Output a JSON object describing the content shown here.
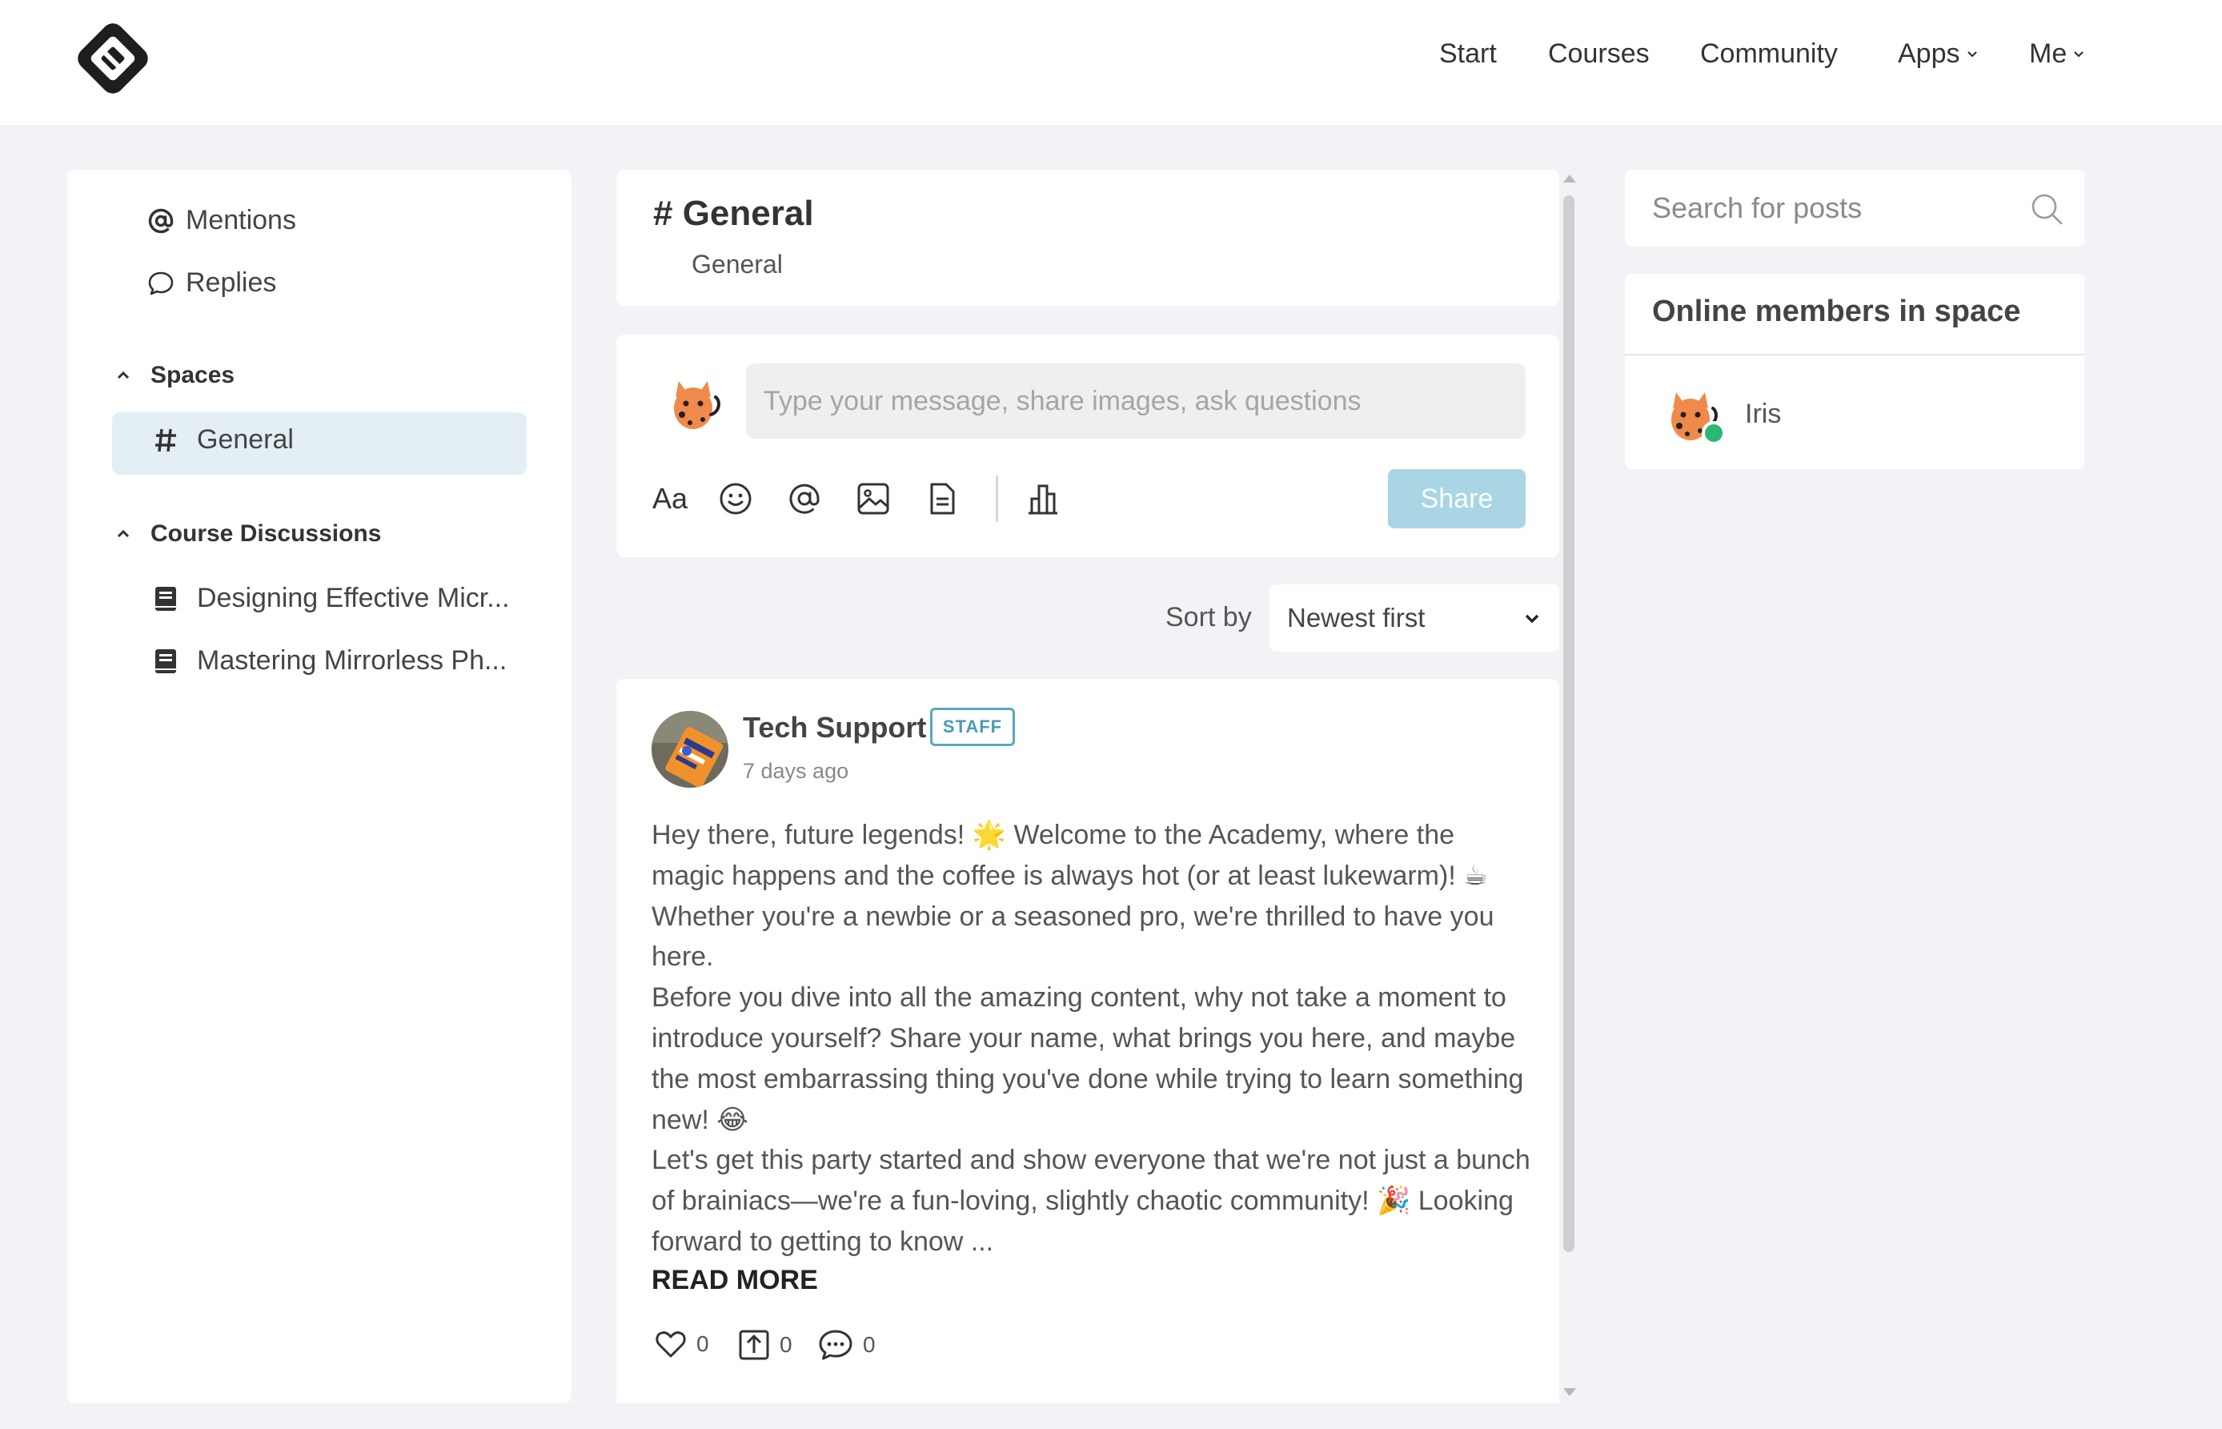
{
  "nav": {
    "items": [
      {
        "label": "Start"
      },
      {
        "label": "Courses"
      },
      {
        "label": "Community"
      },
      {
        "label": "Apps"
      },
      {
        "label": "Me"
      }
    ]
  },
  "sidebar": {
    "mentions": "Mentions",
    "replies": "Replies",
    "spaces_heading": "Spaces",
    "spaces": [
      {
        "label": "General"
      }
    ],
    "courses_heading": "Course Discussions",
    "courses": [
      {
        "label": "Designing Effective Micr..."
      },
      {
        "label": "Mastering Mirrorless Ph..."
      }
    ]
  },
  "space": {
    "title": "# General",
    "subtitle": "General"
  },
  "composer": {
    "placeholder": "Type your message, share images, ask questions",
    "format_label": "Aa",
    "share_label": "Share"
  },
  "sort": {
    "label": "Sort by",
    "selected": "Newest first"
  },
  "post": {
    "author": "Tech Support",
    "badge": "STAFF",
    "time": "7 days ago",
    "body": [
      "Hey there, future legends! 🌟 Welcome to the Academy, where the magic happens and the coffee is always hot (or at least lukewarm)! ☕ Whether you're a newbie or a seasoned pro, we're thrilled to have you here.",
      "Before you dive into all the amazing content, why not take a moment to introduce yourself? Share your name, what brings you here, and maybe the most embarrassing thing you've done while trying to learn something new! 😂",
      "Let's get this party started and show everyone that we're not just a bunch of brainiacs—we're a fun-loving, slightly chaotic community! 🎉 Looking forward to getting to know ..."
    ],
    "read_more": "READ MORE",
    "likes": "0",
    "shares": "0",
    "comments": "0"
  },
  "search": {
    "placeholder": "Search for posts"
  },
  "online": {
    "title": "Online members in space",
    "members": [
      {
        "name": "Iris",
        "status": "online"
      }
    ]
  },
  "colors": {
    "accent_light": "#a9d5e5",
    "active_bg": "#e3eff5",
    "badge": "#5aa7c2",
    "online": "#2ab673",
    "page_bg": "#f3f3f7"
  }
}
